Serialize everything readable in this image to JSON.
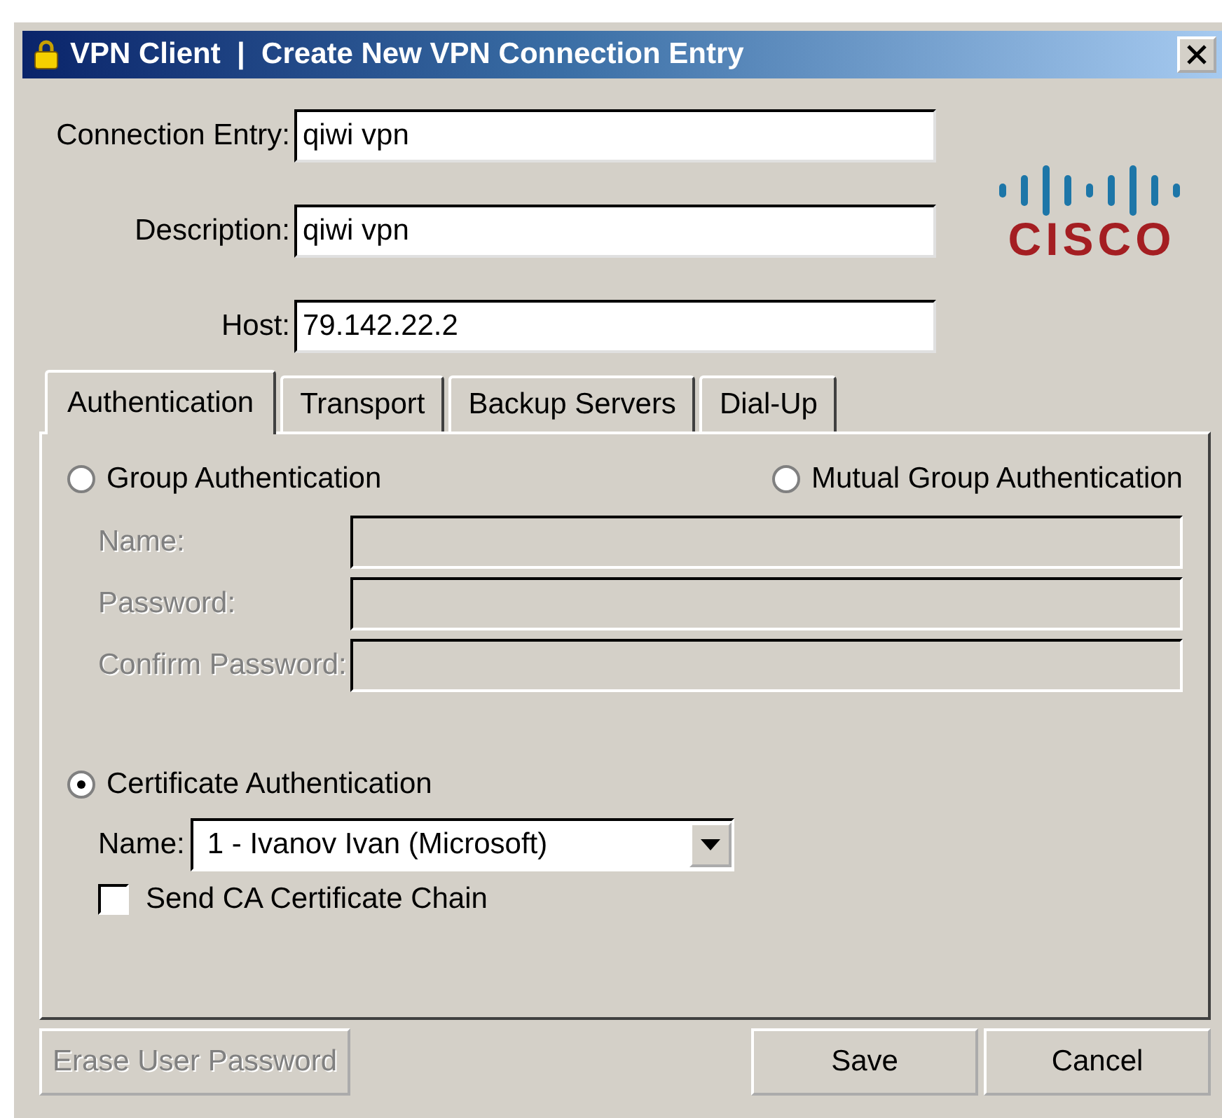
{
  "window": {
    "title": "VPN Client  |  Create New VPN Connection Entry"
  },
  "fields": [
    {
      "label": "Connection Entry:",
      "value": "qiwi vpn"
    },
    {
      "label": "Description:",
      "value": "qiwi vpn"
    },
    {
      "label": "Host:",
      "value": "79.142.22.2"
    }
  ],
  "logo": {
    "text": "CISCO"
  },
  "tabs": [
    {
      "label": "Authentication",
      "selected": true
    },
    {
      "label": "Transport",
      "selected": false
    },
    {
      "label": "Backup Servers",
      "selected": false
    },
    {
      "label": "Dial-Up",
      "selected": false
    }
  ],
  "group_authentication": {
    "label": "Group Authentication",
    "selected": false,
    "mutual": {
      "label": "Mutual Group Authentication",
      "selected": false
    },
    "fields": [
      {
        "label": "Name:",
        "disabled": true
      },
      {
        "label": "Password:",
        "disabled": true
      },
      {
        "label": "Confirm Password:",
        "disabled": true
      }
    ]
  },
  "certificate_authentication": {
    "label": "Certificate Authentication",
    "selected": true,
    "name_label": "Name:",
    "name_value": "1 - Ivanov Ivan (Microsoft)",
    "send_chain": {
      "label": "Send CA Certificate Chain",
      "checked": false
    }
  },
  "buttons": [
    {
      "label": "Erase User Password",
      "disabled": true,
      "kind": "left"
    },
    {
      "label": "Save",
      "disabled": false,
      "kind": "right"
    },
    {
      "label": "Cancel",
      "disabled": false,
      "kind": "right"
    }
  ]
}
